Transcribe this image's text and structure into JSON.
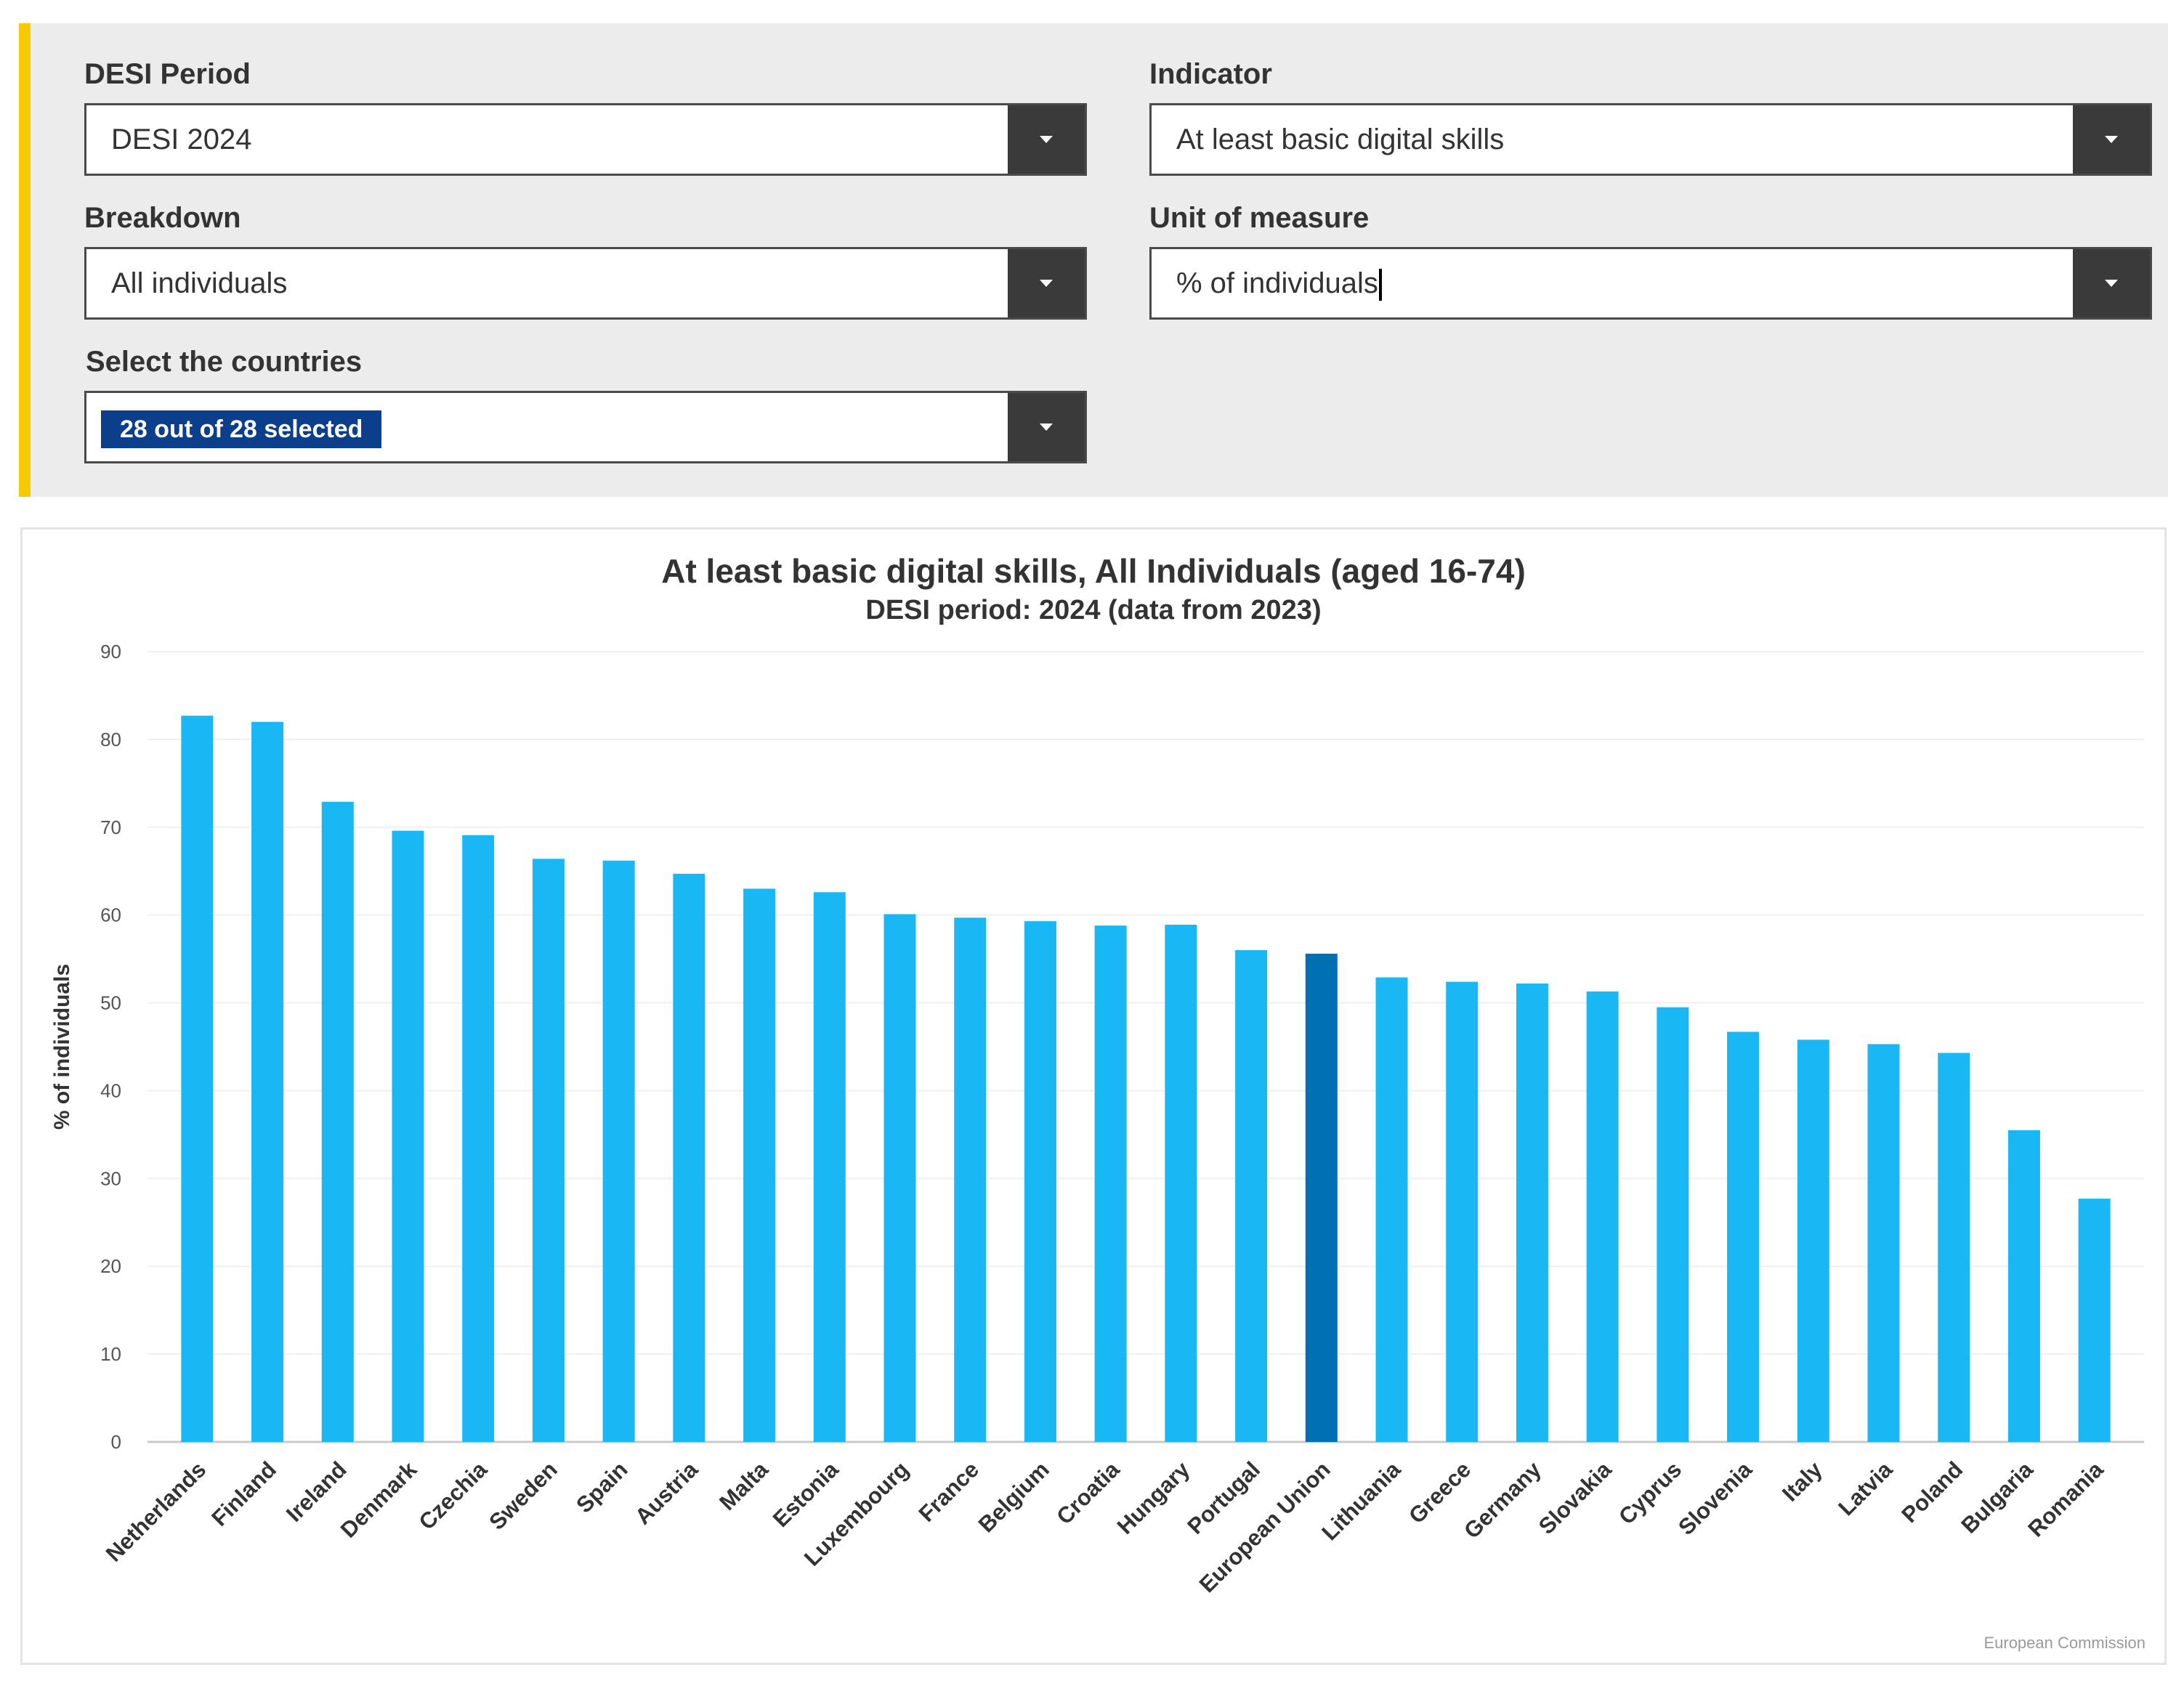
{
  "filters": {
    "period": {
      "label": "DESI Period",
      "value": "DESI 2024"
    },
    "indicator": {
      "label": "Indicator",
      "value": "At least basic digital skills"
    },
    "breakdown": {
      "label": "Breakdown",
      "value": "All individuals"
    },
    "unit": {
      "label": "Unit of measure",
      "value": "% of individuals"
    },
    "countries": {
      "label": "Select the countries",
      "value": "28 out of 28 selected"
    }
  },
  "colors": {
    "bar": "#1ab7f5",
    "highlight": "#0070b5",
    "accent": "#f7c900"
  },
  "credit": "European Commission",
  "chart_data": {
    "type": "bar",
    "title": "At least basic digital skills, All Individuals (aged 16-74)",
    "subtitle": "DESI period: 2024 (data from 2023)",
    "xlabel": "",
    "ylabel": "% of individuals",
    "ylim": [
      0,
      90
    ],
    "yticks": [
      0,
      10,
      20,
      30,
      40,
      50,
      60,
      70,
      80,
      90
    ],
    "grid": true,
    "legend": "none",
    "highlight": "European Union",
    "categories": [
      "Netherlands",
      "Finland",
      "Ireland",
      "Denmark",
      "Czechia",
      "Sweden",
      "Spain",
      "Austria",
      "Malta",
      "Estonia",
      "Luxembourg",
      "France",
      "Belgium",
      "Croatia",
      "Hungary",
      "Portugal",
      "European Union",
      "Lithuania",
      "Greece",
      "Germany",
      "Slovakia",
      "Cyprus",
      "Slovenia",
      "Italy",
      "Latvia",
      "Poland",
      "Bulgaria",
      "Romania"
    ],
    "values": [
      82.7,
      82.0,
      72.9,
      69.6,
      69.1,
      66.4,
      66.2,
      64.7,
      63.0,
      62.6,
      60.1,
      59.7,
      59.3,
      58.8,
      58.9,
      56.0,
      55.6,
      52.9,
      52.4,
      52.2,
      51.3,
      49.5,
      46.7,
      45.8,
      45.3,
      44.3,
      35.5,
      27.7
    ]
  }
}
